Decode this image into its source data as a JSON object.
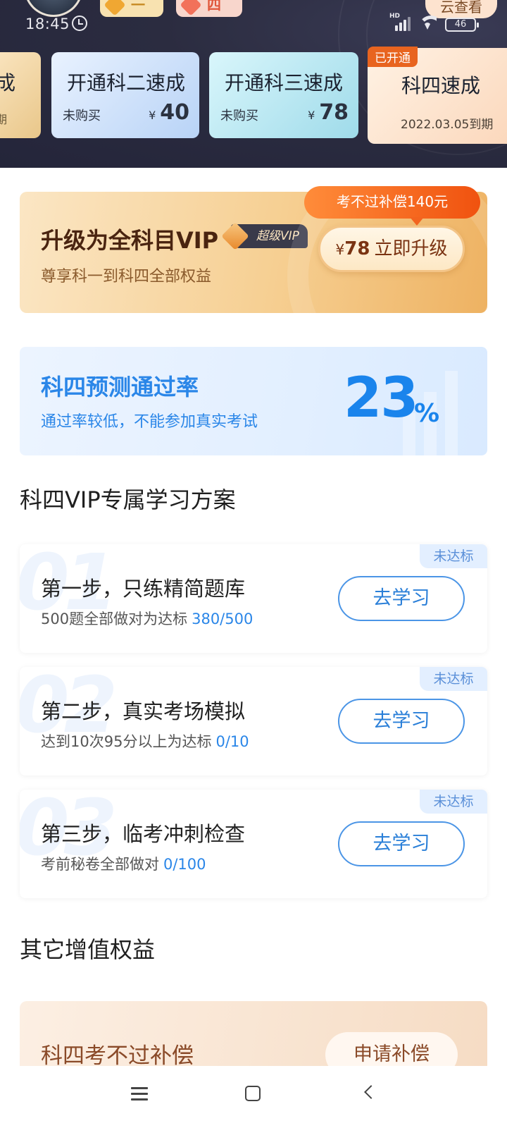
{
  "status_bar": {
    "time": "18:45",
    "network": "HD",
    "battery": "46"
  },
  "header": {
    "subject_chips": [
      {
        "label": "科一"
      },
      {
        "label": "科四"
      }
    ],
    "cloud_button": "云查看",
    "courses": [
      {
        "title": "成",
        "sub": "期"
      },
      {
        "title": "开通科二速成",
        "status": "未购买",
        "currency": "¥",
        "price": "40"
      },
      {
        "title": "开通科三速成",
        "status": "未购买",
        "currency": "¥",
        "price": "78"
      },
      {
        "title": "科四速成",
        "badge": "已开通",
        "expiry": "2022.03.05到期"
      }
    ]
  },
  "vip_upgrade": {
    "title": "升级为全科目VIP",
    "badge": "超级VIP",
    "subtitle": "尊享科一到科四全部权益",
    "bubble": "考不过补偿140元",
    "button_currency": "¥",
    "button_price": "78",
    "button_label": "立即升级"
  },
  "pass_rate": {
    "title": "科四预测通过率",
    "subtitle": "通过率较低，不能参加真实考试",
    "value": "23",
    "unit": "%"
  },
  "plan_section": {
    "title": "科四VIP专属学习方案",
    "steps": [
      {
        "num": "01",
        "title": "第一步，只练精简题库",
        "desc": "500题全部做对为达标",
        "progress": "380/500",
        "tag": "未达标",
        "button": "去学习"
      },
      {
        "num": "02",
        "title": "第二步，真实考场模拟",
        "desc": "达到10次95分以上为达标",
        "progress": "0/10",
        "tag": "未达标",
        "button": "去学习"
      },
      {
        "num": "03",
        "title": "第三步，临考冲刺检查",
        "desc": "考前秘卷全部做对",
        "progress": "0/100",
        "tag": "未达标",
        "button": "去学习"
      }
    ]
  },
  "other_section": {
    "title": "其它增值权益",
    "compensation_title": "科四考不过补偿",
    "compensation_button": "申请补偿"
  },
  "colors": {
    "accent_blue": "#1a84ec",
    "vip_brown": "#4a2410",
    "badge_orange": "#e8641f",
    "header_dark": "#2b2c40"
  },
  "icons": [
    "alarm-icon",
    "signal-icon",
    "wifi-icon",
    "battery-icon",
    "diamond-icon",
    "menu-icon",
    "home-icon",
    "back-icon"
  ]
}
